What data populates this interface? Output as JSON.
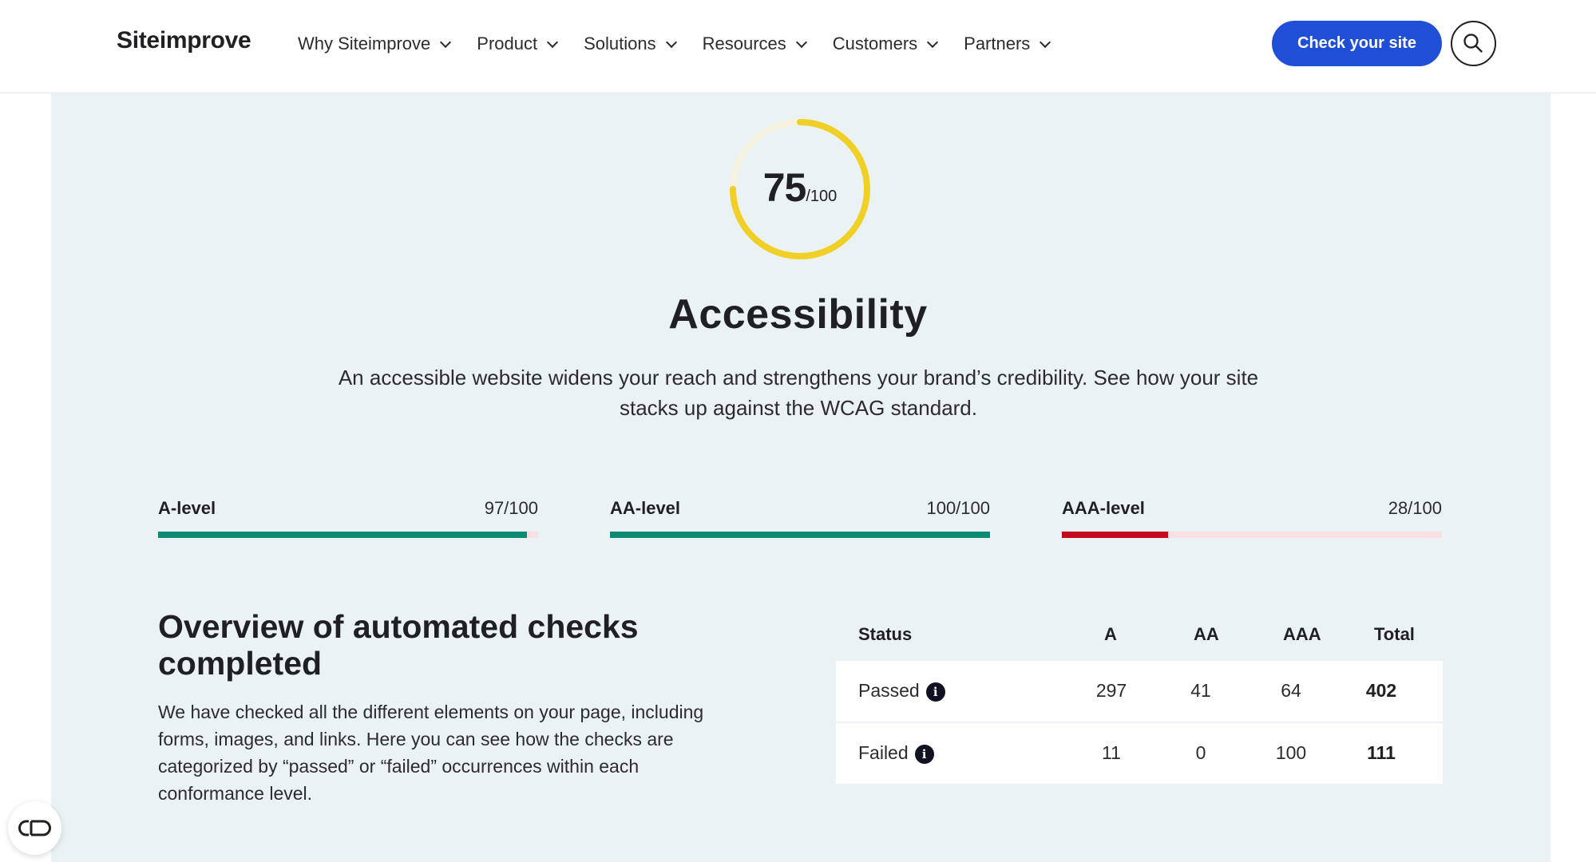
{
  "header": {
    "logo": "Siteimprove",
    "nav": [
      {
        "label": "Why Siteimprove"
      },
      {
        "label": "Product"
      },
      {
        "label": "Solutions"
      },
      {
        "label": "Resources"
      },
      {
        "label": "Customers"
      },
      {
        "label": "Partners"
      }
    ],
    "cta_label": "Check your site",
    "search_icon": "search-icon"
  },
  "score": {
    "value": "75",
    "max": "/100",
    "fraction": 0.75,
    "color": "#f0cf27"
  },
  "section": {
    "title": "Accessibility",
    "lead": "An accessible website widens your reach and strengthens your brand’s credibility. See how your site stacks up against the WCAG standard."
  },
  "levels": [
    {
      "label": "A-level",
      "score": "97/100",
      "fraction": 0.97,
      "color": "#0b8a76"
    },
    {
      "label": "AA-level",
      "score": "100/100",
      "fraction": 1.0,
      "color": "#0b8a76"
    },
    {
      "label": "AAA-level",
      "score": "28/100",
      "fraction": 0.28,
      "color": "#c4091f"
    }
  ],
  "overview": {
    "title": "Overview of automated checks completed",
    "text": "We have checked all the different elements on your page, including forms, images, and links. Here you can see how the checks are categorized by “passed” or “failed” occurrences within each conformance level."
  },
  "table": {
    "headers": [
      "Status",
      "A",
      "AA",
      "AAA",
      "Total"
    ],
    "rows": [
      {
        "status": "Passed",
        "a": "297",
        "aa": "41",
        "aaa": "64",
        "total": "402"
      },
      {
        "status": "Failed",
        "a": "11",
        "aa": "0",
        "aaa": "100",
        "total": "111"
      }
    ],
    "info_glyph": "i"
  },
  "colors": {
    "brand_blue": "#1f4fd6",
    "panel_bg": "#eaf2f4",
    "pass_green": "#0b8a76",
    "fail_red": "#c4091f"
  },
  "widget_icon": "accessibility-toggle-icon"
}
